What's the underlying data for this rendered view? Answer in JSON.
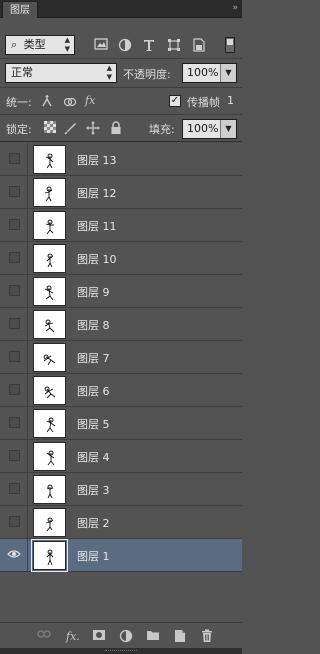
{
  "panel": {
    "tab_label": "图层",
    "collapse_glyph": "»"
  },
  "filter": {
    "search_glyph": "⌕",
    "kind_value": "类型",
    "icons": [
      "image-filter-icon",
      "adjustment-filter-icon",
      "type-filter-icon",
      "shape-filter-icon",
      "smart-object-filter-icon"
    ]
  },
  "blend": {
    "mode_value": "正常",
    "opacity_label": "不透明度:",
    "opacity_value": "100%"
  },
  "unify": {
    "label": "统一:",
    "propagate_label": "传播帧",
    "propagate_checked": "✓",
    "frame_value": "1"
  },
  "lock": {
    "label": "锁定:",
    "fill_label": "填充:",
    "fill_value": "100%"
  },
  "layers": [
    {
      "name": "图层 13",
      "visible": false,
      "selected": false
    },
    {
      "name": "图层 12",
      "visible": false,
      "selected": false
    },
    {
      "name": "图层 11",
      "visible": false,
      "selected": false
    },
    {
      "name": "图层 10",
      "visible": false,
      "selected": false
    },
    {
      "name": "图层 9",
      "visible": false,
      "selected": false
    },
    {
      "name": "图层 8",
      "visible": false,
      "selected": false
    },
    {
      "name": "图层 7",
      "visible": false,
      "selected": false
    },
    {
      "name": "图层 6",
      "visible": false,
      "selected": false
    },
    {
      "name": "图层 5",
      "visible": false,
      "selected": false
    },
    {
      "name": "图层 4",
      "visible": false,
      "selected": false
    },
    {
      "name": "图层 3",
      "visible": false,
      "selected": false
    },
    {
      "name": "图层 2",
      "visible": false,
      "selected": false
    },
    {
      "name": "图层 1",
      "visible": true,
      "selected": true
    }
  ],
  "bottom_icons": [
    "link-layers-icon",
    "fx-icon",
    "add-mask-icon",
    "new-adjustment-icon",
    "new-group-icon",
    "new-layer-icon",
    "delete-layer-icon"
  ],
  "colors": {
    "panel_bg": "#535353",
    "selected_row": "#5a6b82",
    "field_bg": "#e4e4e4"
  }
}
